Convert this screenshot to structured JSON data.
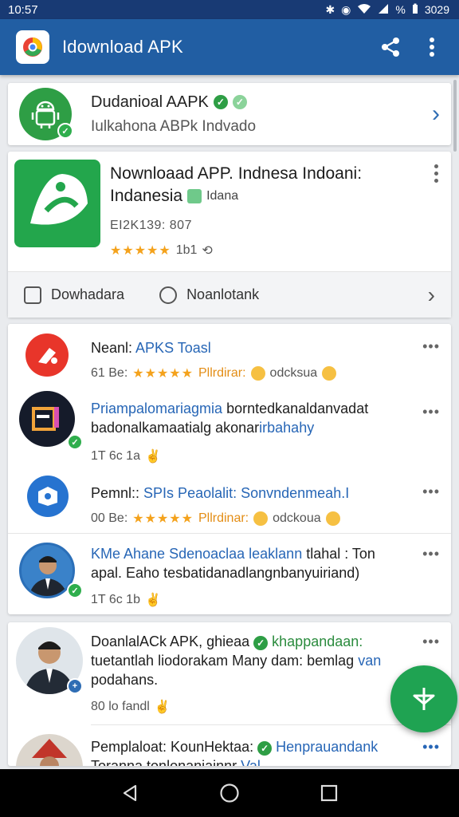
{
  "status_bar": {
    "time": "10:57",
    "battery": "%",
    "clock_right": "3029"
  },
  "app_bar": {
    "title": "Idownload APK",
    "share_icon": "share-icon",
    "menu_icon": "more-vert-icon"
  },
  "featured": {
    "title": "Dudanioal AAPK",
    "subtitle": "Iulkahona ABPk Indvado"
  },
  "app_card": {
    "title_line1": "Nownloaad APP. Indnesa Indoani:",
    "title_line2": "Indanesia",
    "tag": "Idana",
    "meta": "EI2K139: 807",
    "rating_count": "1b1",
    "actions": [
      {
        "label": "Dowhadara",
        "icon": "download-icon"
      },
      {
        "label": "Noanlotank",
        "icon": "chat-icon"
      }
    ]
  },
  "list": [
    {
      "title": "Neanl:",
      "title_blue": "APKS Toasl",
      "sub_prefix": "61 Be:",
      "sub_orange": "Pllrdirar:",
      "sub_suffix": "odcksua"
    },
    {
      "title_blue": "Priampalomariagmia",
      "title": " borntedkanaldanvadat badonalkamaatialg akonar",
      "title_blue2": "irbahahy",
      "sub_prefix": "1T 6c 1a"
    },
    {
      "title": "Pemnl::",
      "title_blue": "SPIs Peaolalit: Sonvndenmeah.I",
      "sub_prefix": "00 Be:",
      "sub_orange": "Pllrdinar:",
      "sub_suffix": "odckoua"
    },
    {
      "title_blue": "KMe Ahane Sdenoaclaa leaklann",
      "title": " tlahal : Ton apal. Eaho tesbatidanadlangnbanyuiriand)",
      "sub_prefix": "1T 6c 1b"
    }
  ],
  "list2": [
    {
      "title": "DoanlalACk APK, ghieaa",
      "title_green": "khappandaan:",
      "title_rest": " tuetantlah liodorakam Many dam: bemlag",
      "title_blue": "van",
      "title_end": " podahans.",
      "sub_prefix": "80 lo fandl"
    },
    {
      "title": "Pemplaloat: KounHektaa:",
      "title_blue": "Henprauandank",
      "title_line2": "Toranna tonlonaniainnr",
      "title_line2_blue": "Val"
    }
  ],
  "colors": {
    "app_bar": "#215ea3",
    "status_bar": "#183a74",
    "accent_green": "#1fa352",
    "star": "#f4a21c"
  }
}
